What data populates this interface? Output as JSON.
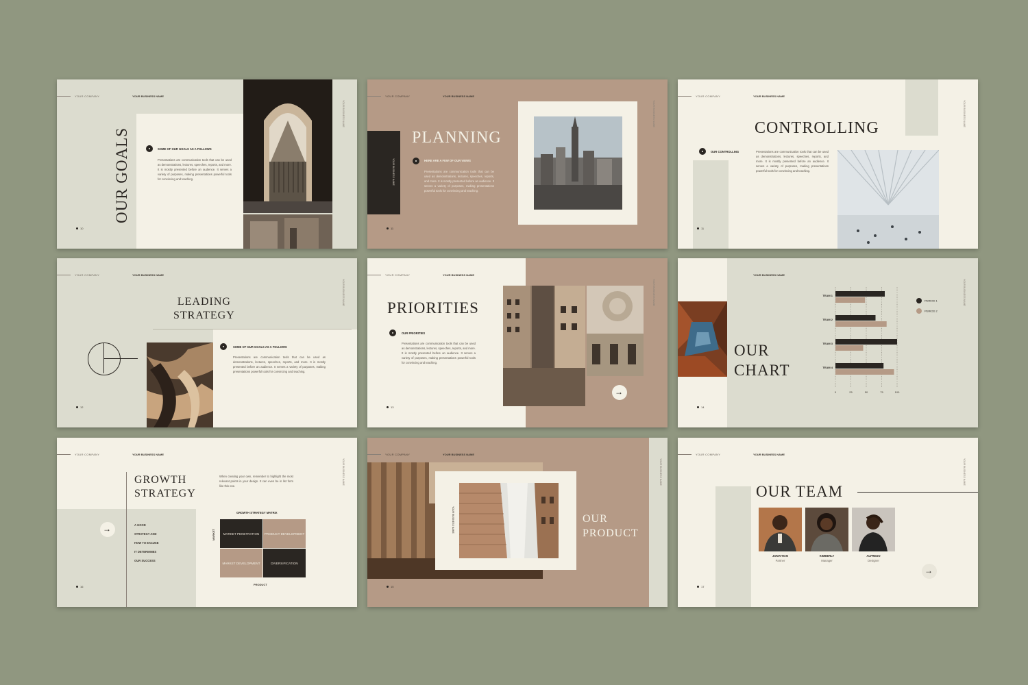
{
  "slides": {
    "goals": {
      "company": "YOUR COMPANY",
      "business": "YOUR BUSINESS NAME",
      "title": "OUR GOALS",
      "bullet_title": "SOME OF OUR GOALS AS A FOLLOWS",
      "body": "Presentations are communication tools that can be used as demonstrations, lectures, speeches, reports, and more. It is mostly presented before an audience. It serves a variety of purposes, making presentations powerful tools for convincing and teaching.",
      "page": "10"
    },
    "planning": {
      "company": "YOUR COMPANY",
      "business": "YOUR BUSINESS NAME",
      "title": "PLANNING",
      "side_label": "YOUR BUSINESS NAME",
      "bullet_title": "HERE ARE A FEW OF OUR VIEWS",
      "body": "Presentations are communication tools that can be used as demonstrations, lectures, speeches, reports, and more. It is mostly presented before an audience. It serves a variety of purposes, making presentations powerful tools for convincing and teaching.",
      "page": "11"
    },
    "controlling": {
      "company": "YOUR COMPANY",
      "business": "YOUR BUSINESS NAME",
      "title": "CONTROLLING",
      "bullet_title": "OUR CONTROLLING",
      "body": "Presentations are communication tools that can be used as demonstrations, lectures, speeches, reports, and more. It is mostly presented before an audience. It serves a variety of purposes, making presentations powerful tools for convincing and teaching.",
      "page": "11"
    },
    "leading": {
      "company": "YOUR COMPANY",
      "business": "YOUR BUSINESS NAME",
      "title_line1": "LEADING",
      "title_line2": "STRATEGY",
      "bullet_title": "SOME OF OUR GOALS AS A FOLLOWS",
      "body": "Presentations are communication tools that can be used as demonstrations, lectures, speeches, reports, and more. It is mostly presented before an audience. It serves a variety of purposes, making presentations powerful tools for convincing and teaching.",
      "page": "12"
    },
    "priorities": {
      "company": "YOUR COMPANY",
      "business": "YOUR BUSINESS NAME",
      "title": "PRIORITIES",
      "bullet_title": "OUR PRIORITIES",
      "body": "Presentations are communication tools that can be used as demonstrations, lectures, speeches, reports, and more. It is mostly presented before an audience. It serves a variety of purposes, making presentations powerful tools for convincing and teaching.",
      "page": "13"
    },
    "chart": {
      "company": "YOUR COMPANY",
      "business": "YOUR BUSINESS NAME",
      "title_line1": "OUR",
      "title_line2": "CHART",
      "page": "14"
    },
    "growth": {
      "company": "YOUR COMPANY",
      "business": "YOUR BUSINESS NAME",
      "title_line1": "GROWTH",
      "title_line2": "STRATEGY",
      "intro": "When creating your own, remember to highlight the most relevant points in your design. It can even be in list form like this one.",
      "list": [
        "A GOOD",
        "STRATEGY AND",
        "HOW TO EXCUSE",
        "IT DETERMINES",
        "OUR SUCCESS"
      ],
      "matrix_title": "GROWTH STRATEGY MATRIX",
      "market_label": "MARKET",
      "product_label": "PRODUCT",
      "cells": [
        "MARKET PENETRATION",
        "PRODUCT DEVELOPMENT",
        "MARKET DEVELOPMENT",
        "DIVERSIFICATION"
      ],
      "page": "16"
    },
    "product": {
      "company": "YOUR COMPANY",
      "business": "YOUR BUSINESS NAME",
      "title_line1": "OUR",
      "title_line2": "PRODUCT",
      "side_label": "YOUR BUSINESS NAME",
      "page": "15"
    },
    "team": {
      "company": "YOUR COMPANY",
      "business": "YOUR BUSINESS NAME",
      "title": "OUR TEAM",
      "members": [
        {
          "name": "JONATHAN",
          "role": "Partner"
        },
        {
          "name": "KIMBERLY",
          "role": "Manager"
        },
        {
          "name": "ALFREDO",
          "role": "Designer"
        }
      ],
      "page": "17"
    }
  },
  "chart_data": {
    "type": "bar",
    "categories": [
      "TEAM 1",
      "TEAM 2",
      "TEAM 3",
      "TEAM 4"
    ],
    "series": [
      {
        "name": "PERIOD 1",
        "values": [
          80,
          65,
          100,
          78
        ],
        "color": "#2a2622"
      },
      {
        "name": "PERIOD 2",
        "values": [
          48,
          83,
          45,
          95
        ],
        "color": "#b59a86"
      }
    ],
    "x_ticks": [
      "0",
      "25",
      "50",
      "75",
      "100"
    ],
    "xlim": [
      0,
      100
    ],
    "orientation": "horizontal",
    "legend": "top-right"
  },
  "colors": {
    "background": "#909780",
    "cream": "#f4f1e6",
    "sage": "#dcdccf",
    "tan": "#b59a86",
    "dark": "#2a2622"
  }
}
